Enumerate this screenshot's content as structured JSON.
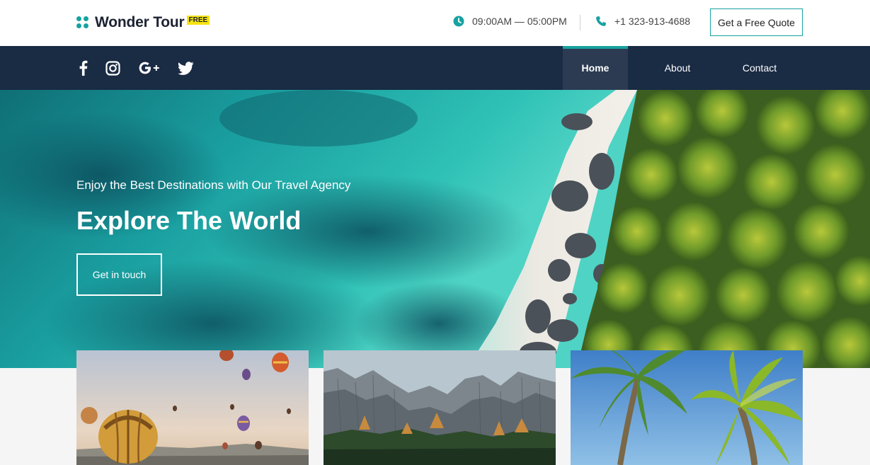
{
  "header": {
    "logo_text": "Wonder Tour",
    "logo_badge": "FREE",
    "hours": "09:00AM — 05:00PM",
    "phone": "+1 323-913-4688",
    "quote_button": "Get a Free Quote",
    "hours_icon": "clock-icon",
    "phone_icon": "phone-icon"
  },
  "nav": {
    "social": [
      "facebook-icon",
      "instagram-icon",
      "google-plus-icon",
      "twitter-icon"
    ],
    "items": [
      {
        "label": "Home",
        "active": true
      },
      {
        "label": "About",
        "active": false
      },
      {
        "label": "Contact",
        "active": false
      }
    ]
  },
  "hero": {
    "subtitle": "Enjoy the Best Destinations with Our Travel Agency",
    "title": "Explore The World",
    "button": "Get in touch"
  },
  "cards": [
    {
      "image": "hot-air-balloons"
    },
    {
      "image": "mountains"
    },
    {
      "image": "palm-trees"
    }
  ],
  "colors": {
    "accent": "#17a2a0",
    "navbar": "#1a2b44",
    "nav_active": "#2c3b52",
    "badge": "#f5e312",
    "logo_text": "#1c2331"
  }
}
